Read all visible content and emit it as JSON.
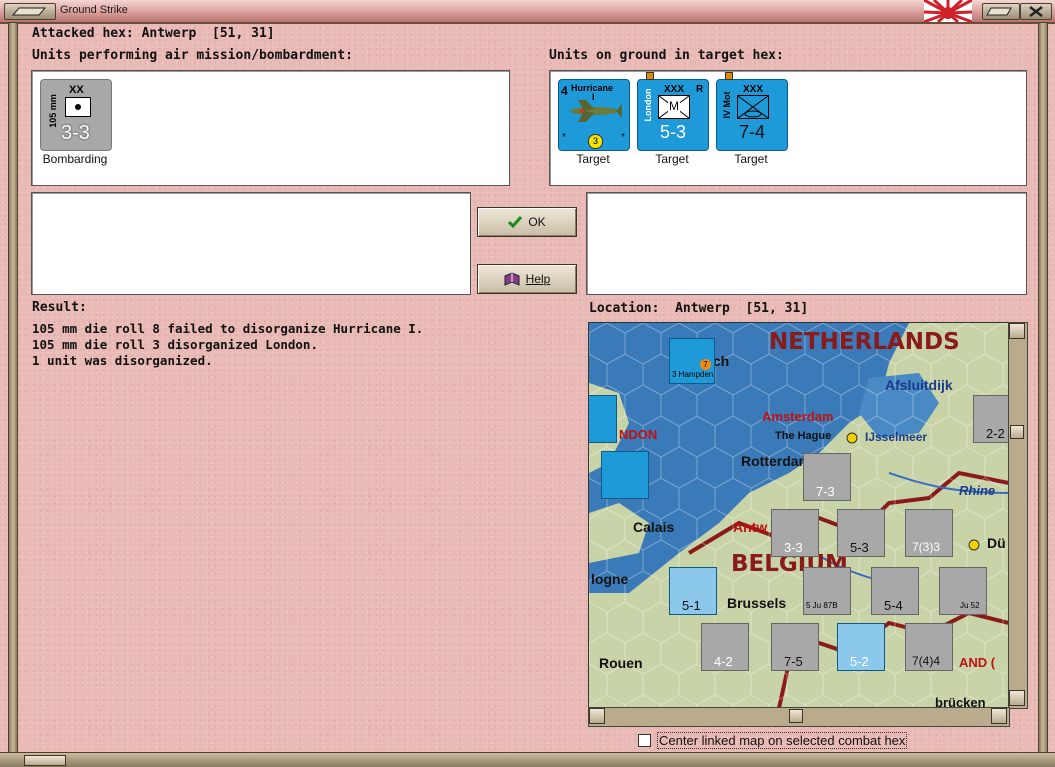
{
  "window": {
    "title": "Ground Strike"
  },
  "header": {
    "attacked_hex": "Attacked hex: Antwerp  [51, 31]"
  },
  "air_units": {
    "label": "Units performing air mission/bombardment:",
    "items": [
      {
        "size": "XX",
        "side": "105 mm",
        "strength": "3-3",
        "caption": "Bombarding"
      }
    ]
  },
  "ground_units": {
    "label": "Units on ground in target hex:",
    "items": [
      {
        "top": "Hurricane",
        "sub": "I",
        "corner": "4",
        "badge": "3",
        "caption": "Target"
      },
      {
        "size": "XXX",
        "side": "London",
        "flag": "R",
        "type": "M",
        "strength": "5-3",
        "caption": "Target"
      },
      {
        "size": "XXX",
        "side": "IV Mot",
        "strength": "7-4",
        "caption": "Target"
      }
    ]
  },
  "buttons": {
    "ok": "OK",
    "help": "Help"
  },
  "result": {
    "label": "Result:",
    "lines": [
      "105 mm die roll 8 failed to disorganize Hurricane I.",
      "105 mm die roll 3 disorganized London.",
      "1 unit was disorganized."
    ]
  },
  "location": {
    "label": "Location:  Antwerp  [51, 31]"
  },
  "map": {
    "labels": {
      "netherlands": "NETHERLANDS",
      "belgium": "BELGIUM",
      "afsluitdijk": "Afsluitdijk",
      "amsterdam": "Amsterdam",
      "the_hague": "The Hague",
      "ijsselmeer": "IJsselmeer",
      "rotterdam": "Rotterdam",
      "rhine": "Rhine",
      "calais": "Calais",
      "antwerp": "Antw",
      "brussels": "Brussels",
      "rouen": "Rouen",
      "london": "NDON",
      "ich": "ich",
      "logne": "logne",
      "du": "Dü",
      "and": "AND (",
      "brucken": "brücken"
    },
    "counters": [
      {
        "name": "hampden",
        "text": "3 Hampden",
        "badge": "7"
      },
      {
        "name": "7-3",
        "text": "7-3"
      },
      {
        "name": "3-3",
        "text": "3-3"
      },
      {
        "name": "5-3",
        "text": "5-3"
      },
      {
        "name": "7(3)3",
        "text": "7(3)3"
      },
      {
        "name": "5-1",
        "text": "5-1"
      },
      {
        "name": "stuka",
        "text": "5 Ju 87B"
      },
      {
        "name": "5-4",
        "text": "5-4"
      },
      {
        "name": "ju52",
        "text": "Ju 52"
      },
      {
        "name": "4-2",
        "text": "4-2"
      },
      {
        "name": "7-5",
        "text": "7-5"
      },
      {
        "name": "5-2",
        "text": "5-2"
      },
      {
        "name": "7(4)4",
        "text": "7(4)4"
      },
      {
        "name": "2-2",
        "text": "2-2"
      }
    ]
  },
  "footer": {
    "checkbox_label": "Center linked map on selected combat hex",
    "checked": false
  },
  "colors": {
    "counter_blue": "#1e9ad8",
    "counter_gray": "#a8a8a8",
    "title_red": "#8b1a1a",
    "bg_pink": "#e9b9b6"
  }
}
